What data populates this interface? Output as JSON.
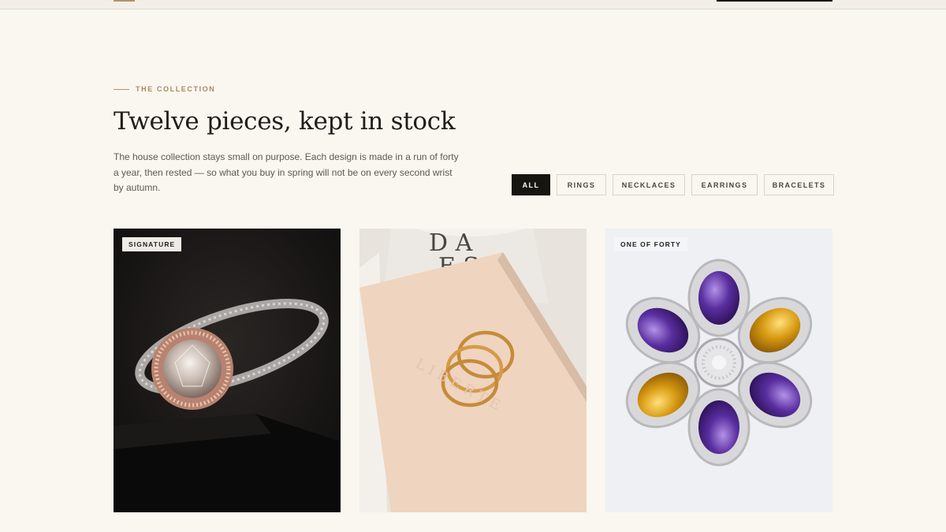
{
  "header": {
    "cart_label": ""
  },
  "collection": {
    "eyebrow": "THE COLLECTION",
    "title": "Twelve pieces, kept in stock",
    "intro": "The house collection stays small on purpose. Each design is made in a run of forty a year, then rested — so what you buy in spring will not be on every second wrist by autumn."
  },
  "filters": [
    {
      "label": "ALL",
      "active": true
    },
    {
      "label": "RINGS",
      "active": false
    },
    {
      "label": "NECKLACES",
      "active": false
    },
    {
      "label": "EARRINGS",
      "active": false
    },
    {
      "label": "BRACELETS",
      "active": false
    }
  ],
  "products": [
    {
      "badge": "SIGNATURE",
      "image": "rose-gold halo diamond ring on dark stand",
      "title": ""
    },
    {
      "badge": "",
      "image": "three stacked gold hoop rings on peach box",
      "title": ""
    },
    {
      "badge": "ONE OF FORTY",
      "image": "silver flower brooch with amethyst and citrine",
      "title": ""
    }
  ],
  "colors": {
    "background": "#faf7f1",
    "accent": "#b39368",
    "active_filter": "#17150f"
  }
}
